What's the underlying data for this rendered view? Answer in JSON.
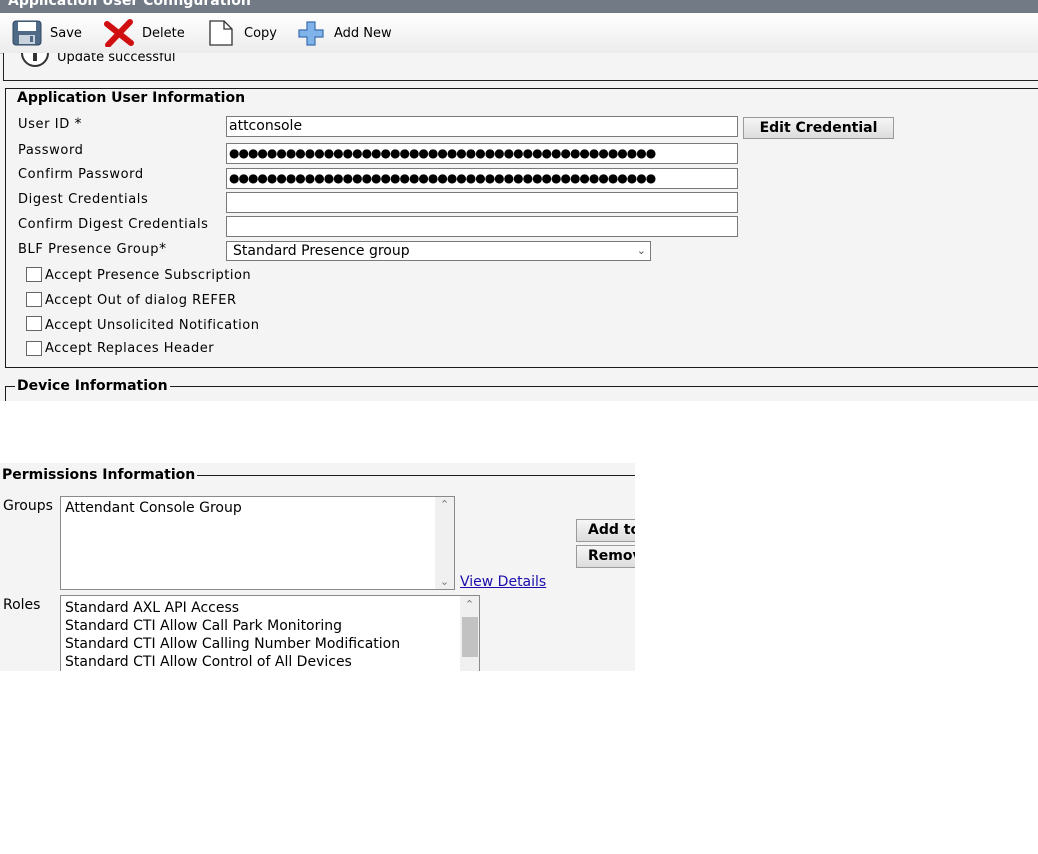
{
  "window": {
    "title": "Application User Configuration"
  },
  "toolbar": {
    "save": "Save",
    "delete": "Delete",
    "copy": "Copy",
    "add_new": "Add New"
  },
  "status": {
    "message": "Update successful"
  },
  "app_user": {
    "legend": "Application User Information",
    "user_id_label": "User ID",
    "user_id_value": "attconsole",
    "edit_credential": "Edit Credential",
    "password_label": "Password",
    "password_value": "●●●●●●●●●●●●●●●●●●●●●●●●●●●●●●●●●●●●●●●●●●●●●",
    "confirm_password_label": "Confirm Password",
    "confirm_password_value": "●●●●●●●●●●●●●●●●●●●●●●●●●●●●●●●●●●●●●●●●●●●●●",
    "digest_label": "Digest Credentials",
    "digest_value": "",
    "confirm_digest_label": "Confirm Digest Credentials",
    "confirm_digest_value": "",
    "blf_label": "BLF Presence Group",
    "blf_value": "Standard Presence group",
    "required_mark": "*",
    "checkboxes": [
      {
        "label": "Accept Presence Subscription",
        "checked": false
      },
      {
        "label": "Accept Out of dialog REFER",
        "checked": false
      },
      {
        "label": "Accept Unsolicited Notification",
        "checked": false
      },
      {
        "label": "Accept Replaces Header",
        "checked": false
      }
    ]
  },
  "device": {
    "legend": "Device Information"
  },
  "permissions": {
    "legend": "Permissions Information",
    "groups_label": "Groups",
    "groups": [
      "Attendant Console Group"
    ],
    "view_details": "View Details",
    "add_button": "Add to",
    "remove_button": "Remov",
    "roles_label": "Roles",
    "roles": [
      "Standard AXL API Access",
      "Standard CTI Allow Call Park Monitoring",
      "Standard CTI Allow Calling Number Modification",
      "Standard CTI Allow Control of All Devices"
    ]
  },
  "colors": {
    "title_bar": "#717a85",
    "panel_bg": "#f4f4f4",
    "delete_red": "#d01010",
    "add_blue": "#4a8fd8",
    "link": "#1a0dab"
  }
}
